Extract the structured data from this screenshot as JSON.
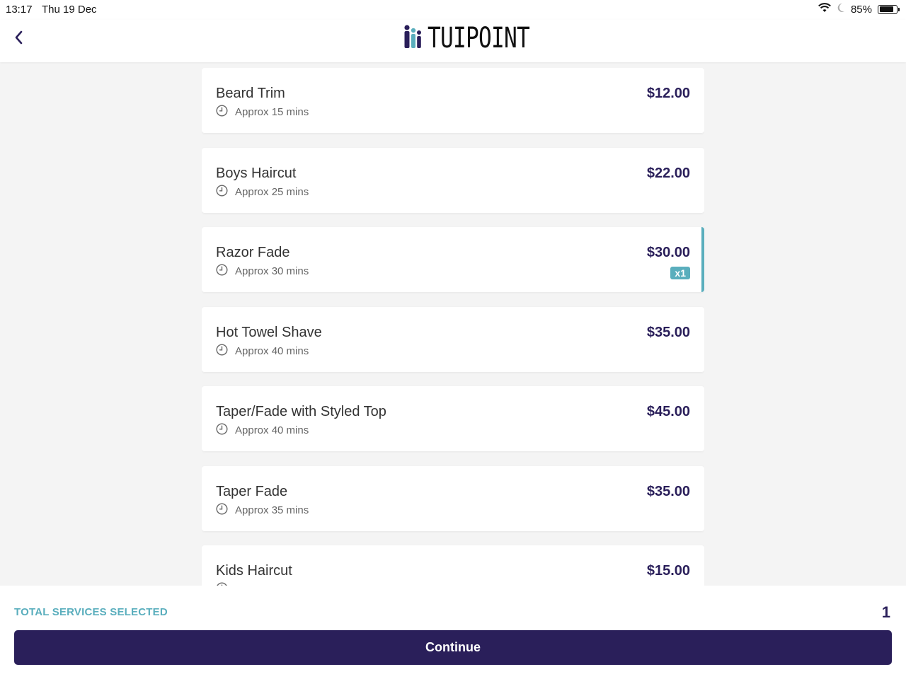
{
  "status_bar": {
    "time": "13:17",
    "date": "Thu 19 Dec",
    "battery": "85%",
    "battery_level": 0.85
  },
  "header": {
    "logo_text": "TUIPOINT",
    "back_icon": "chevron-left-icon"
  },
  "services": [
    {
      "name": "Beard Trim",
      "duration": "Approx 15 mins",
      "price": "$12.00",
      "selected": false
    },
    {
      "name": "Boys Haircut",
      "duration": "Approx 25 mins",
      "price": "$22.00",
      "selected": false
    },
    {
      "name": "Razor Fade",
      "duration": "Approx 30 mins",
      "price": "$30.00",
      "selected": true,
      "quantity": "x1"
    },
    {
      "name": "Hot Towel Shave",
      "duration": "Approx 40 mins",
      "price": "$35.00",
      "selected": false
    },
    {
      "name": "Taper/Fade with Styled Top",
      "duration": "Approx 40 mins",
      "price": "$45.00",
      "selected": false
    },
    {
      "name": "Taper Fade",
      "duration": "Approx 35 mins",
      "price": "$35.00",
      "selected": false
    },
    {
      "name": "Kids Haircut",
      "duration": "",
      "price": "$15.00",
      "selected": false
    }
  ],
  "footer": {
    "total_label": "TOTAL SERVICES SELECTED",
    "total_count": "1",
    "continue_label": "Continue"
  },
  "colors": {
    "primary": "#2a1f5a",
    "accent": "#5aaebd",
    "background": "#f4f4f4"
  }
}
